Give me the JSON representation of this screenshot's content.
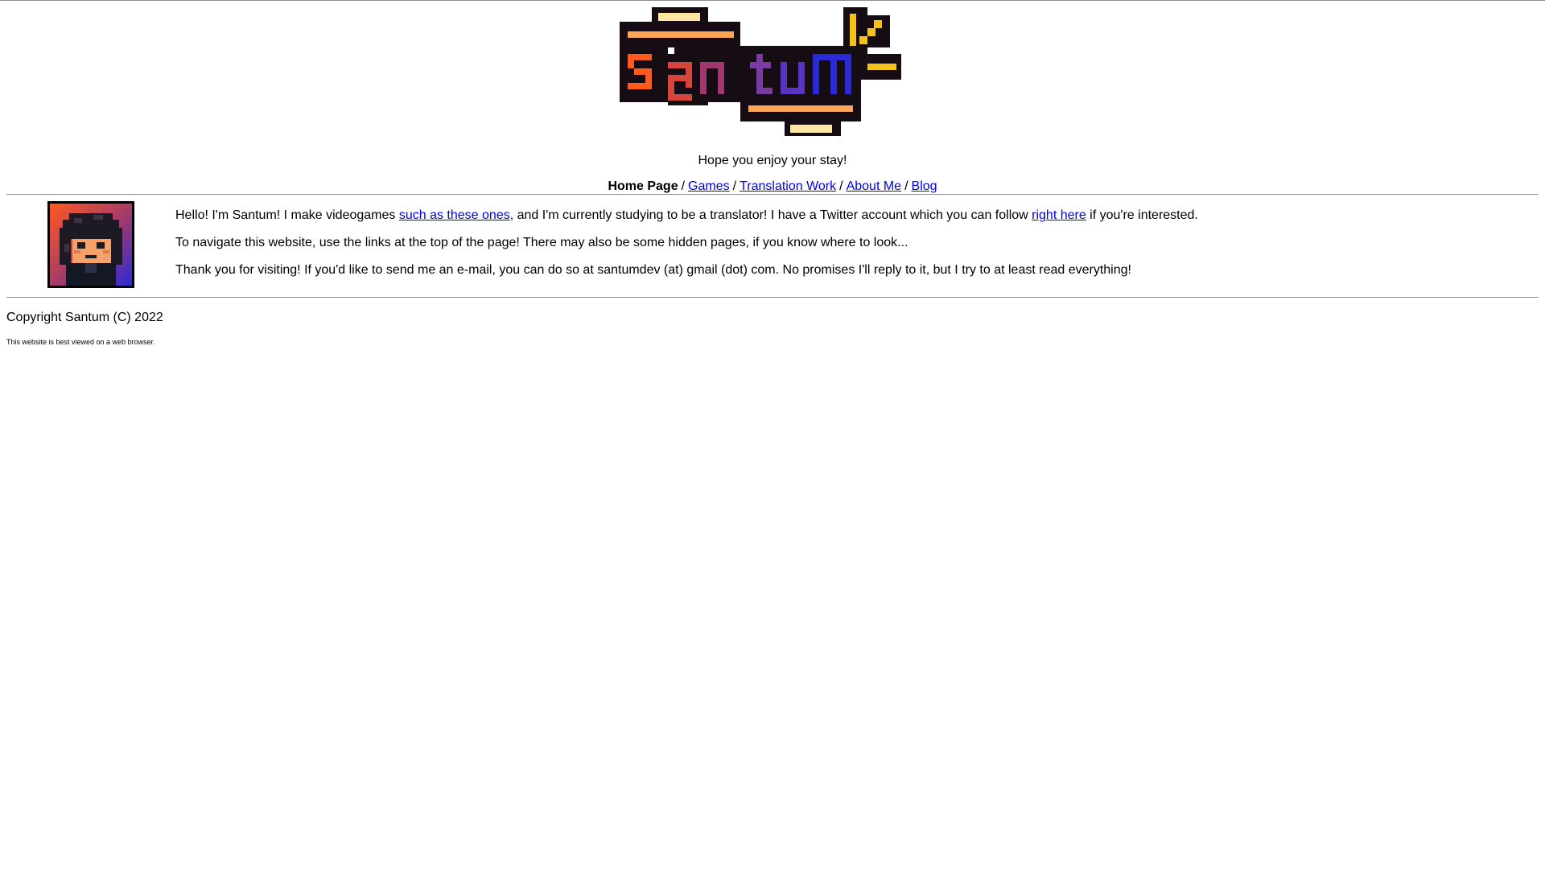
{
  "header": {
    "logo_text": "Santum",
    "tagline": "Hope you enjoy your stay!"
  },
  "nav": {
    "current": "Home Page",
    "separator": "/",
    "links": [
      {
        "label": "Games"
      },
      {
        "label": "Translation Work"
      },
      {
        "label": "About Me"
      },
      {
        "label": "Blog"
      }
    ]
  },
  "intro": {
    "p1_a": "Hello! I'm Santum! I make videogames ",
    "p1_link1": "such as these ones",
    "p1_b": ", and I'm currently studying to be a translator! I have a Twitter account which you can follow ",
    "p1_link2": "right here",
    "p1_c": " if you're interested.",
    "p2": "To navigate this website, use the links at the top of the page! There may also be some hidden pages, if you know where to look...",
    "p3": "Thank you for visiting! If you'd like to send me an e-mail, you can do so at santumdev (at) gmail (dot) com. No promises I'll reply to it, but I try to at least read everything!"
  },
  "footer": {
    "copyright": "Copyright Santum (C) 2022",
    "note": "This website is best viewed on a web browser."
  },
  "colors": {
    "link": "#0000ee",
    "logo_orange": "#ff5a1f",
    "logo_purple": "#7a3aa0",
    "logo_blue": "#2a2ad6",
    "logo_gold": "#f5c21b",
    "logo_outline": "#160c14"
  }
}
